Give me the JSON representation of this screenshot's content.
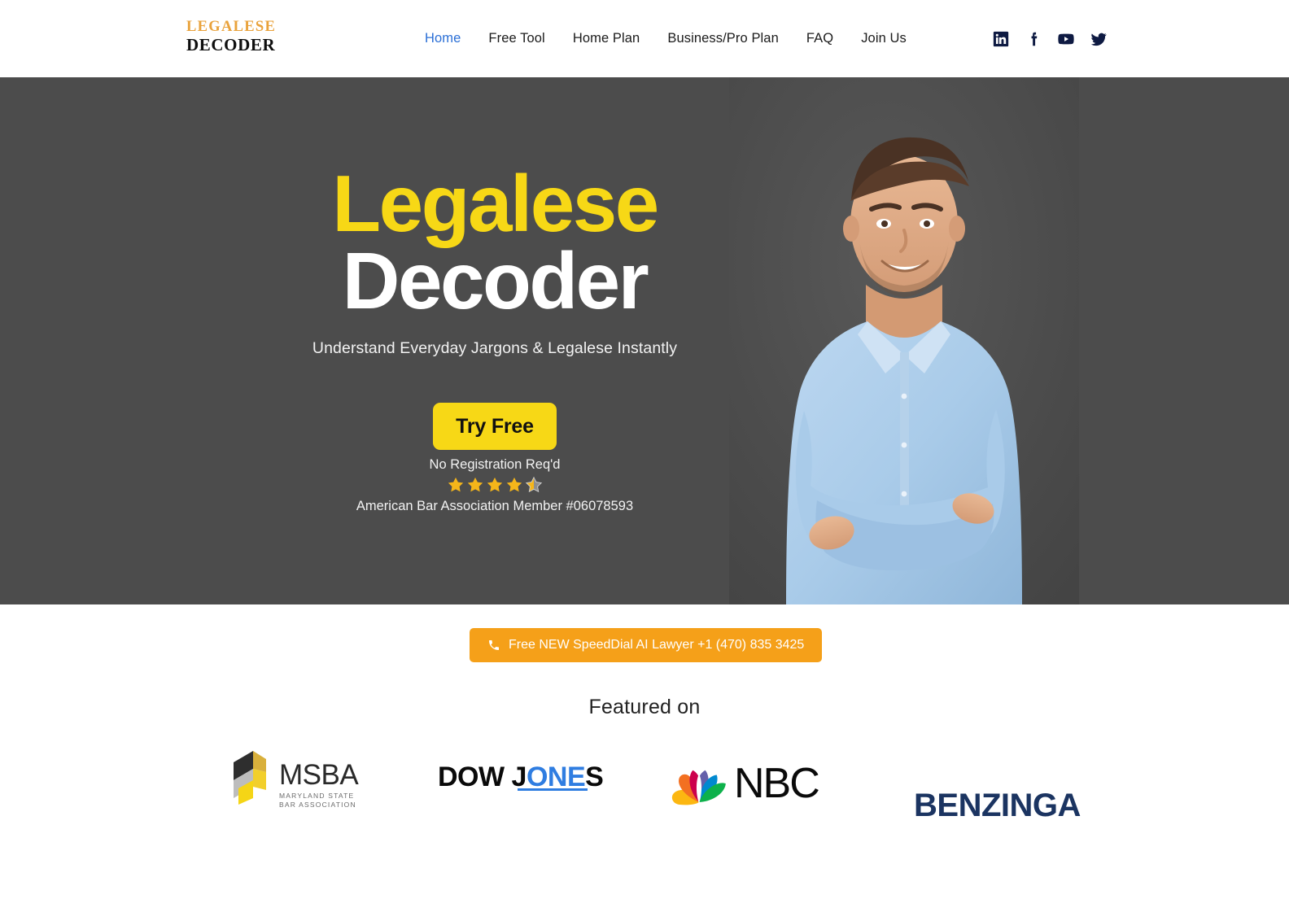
{
  "header": {
    "logo": {
      "line1": "LEGALESE",
      "line2": "DECODER"
    },
    "nav": [
      {
        "label": "Home",
        "active": true
      },
      {
        "label": "Free Tool",
        "active": false
      },
      {
        "label": "Home Plan",
        "active": false
      },
      {
        "label": "Business/Pro Plan",
        "active": false
      },
      {
        "label": "FAQ",
        "active": false
      },
      {
        "label": "Join Us",
        "active": false
      }
    ],
    "social": [
      "linkedin-icon",
      "facebook-icon",
      "youtube-icon",
      "twitter-icon"
    ]
  },
  "hero": {
    "title_line1": "Legalese",
    "title_line2": "Decoder",
    "subtitle": "Understand Everyday Jargons & Legalese Instantly",
    "cta_label": "Try Free",
    "no_registration": "No Registration Req'd",
    "rating_value": 4.5,
    "rating_max": 5,
    "bar_association": "American Bar Association Member #06078593",
    "background_color": "#4c4c4c",
    "accent_yellow": "#F7D816"
  },
  "phone_cta": {
    "label": "Free NEW SpeedDial AI Lawyer +1 (470) 835 3425",
    "icon": "phone-icon",
    "color": "#F5A019"
  },
  "featured": {
    "title": "Featured on",
    "logos": [
      {
        "name": "MSBA",
        "word": "MSBA",
        "sub_line1": "MARYLAND STATE",
        "sub_line2": "BAR ASSOCIATION"
      },
      {
        "name": "Dow Jones",
        "part1": "DOW J",
        "part2": "ONE",
        "part3": "S"
      },
      {
        "name": "NBC",
        "word": "NBC"
      },
      {
        "name": "Benzinga",
        "word": "BENZINGA"
      }
    ]
  }
}
